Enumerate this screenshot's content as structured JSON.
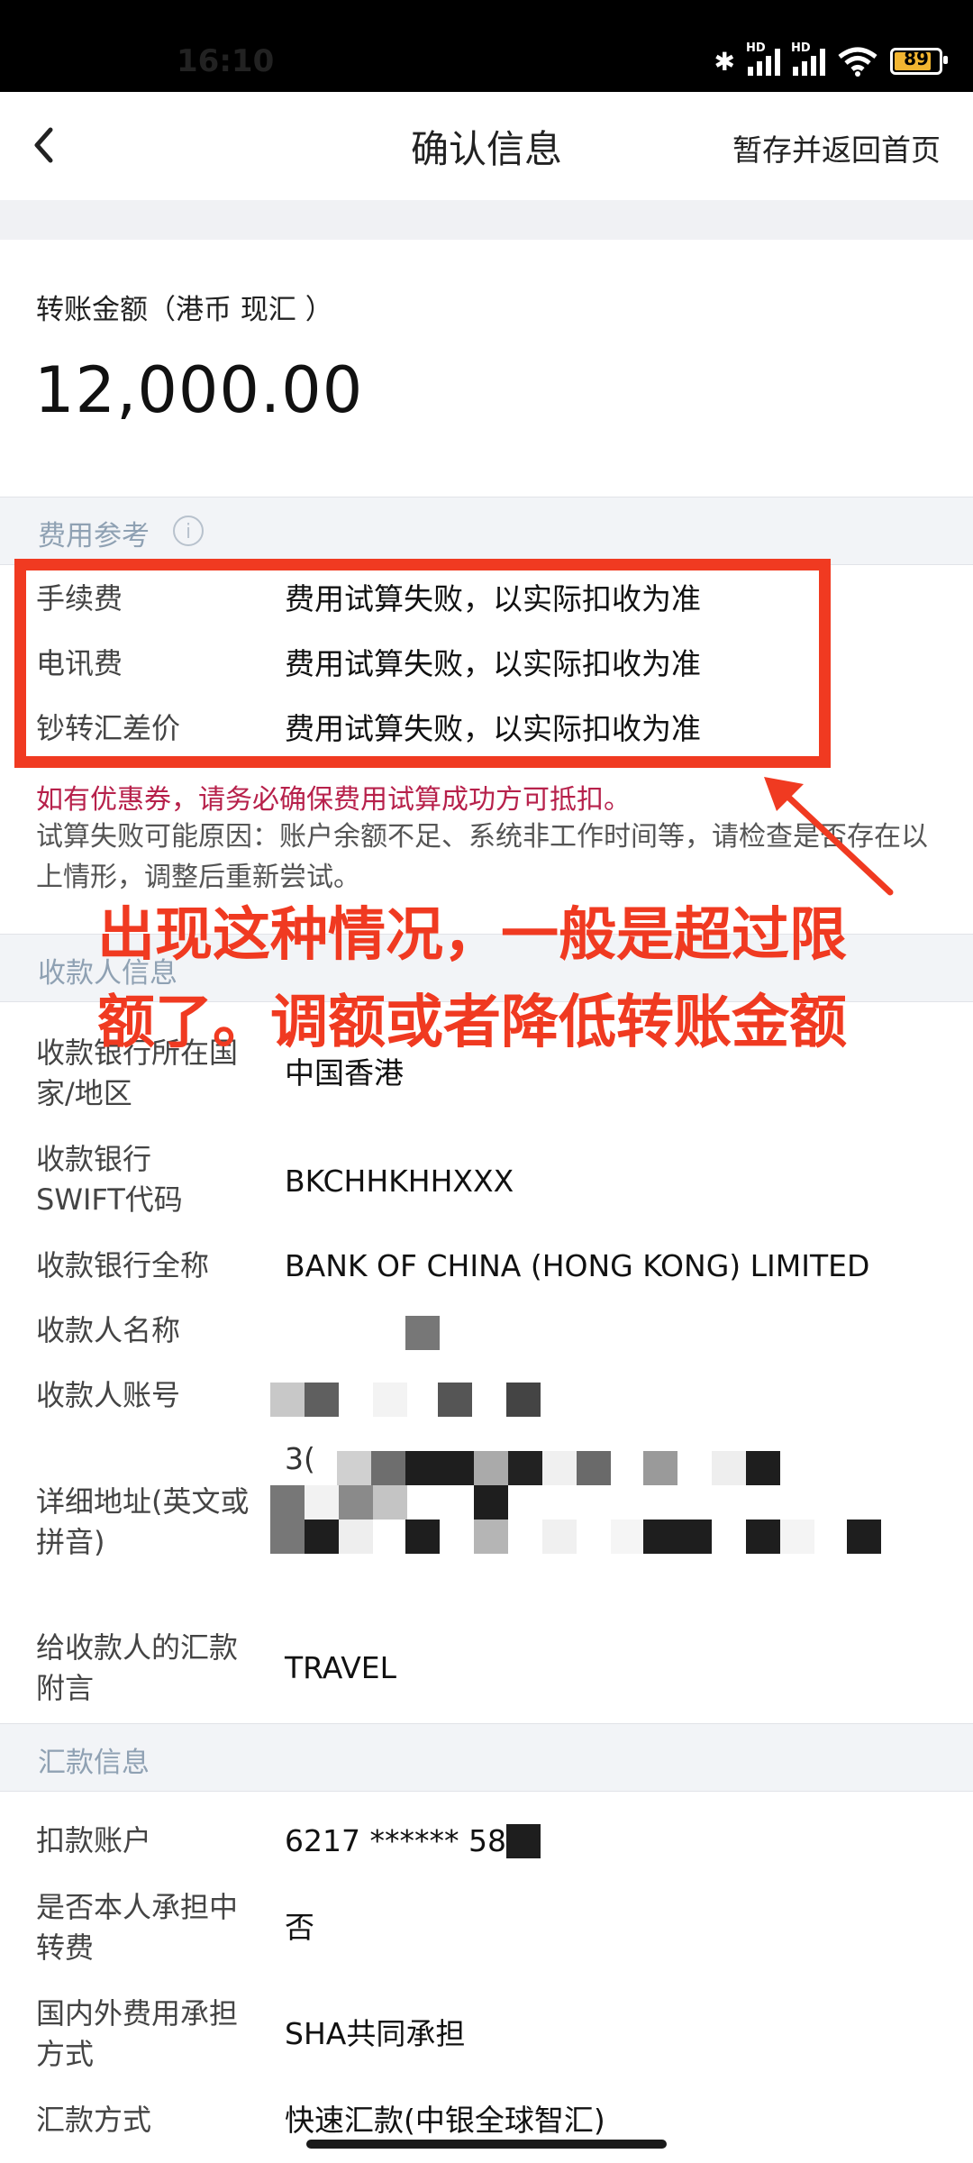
{
  "status_bar": {
    "time": "16:10",
    "battery": "89",
    "signal_badge": "HD",
    "icons": [
      "bluetooth-icon",
      "signal-hd-icon",
      "signal-hd-icon",
      "wifi-icon",
      "battery-icon"
    ]
  },
  "nav": {
    "title": "确认信息",
    "save_label": "暂存并返回首页",
    "back_icon": "chevron-left-icon"
  },
  "amount": {
    "label": "转账金额（港币 现汇 ）",
    "value": "12,000.00"
  },
  "fees": {
    "section_title": "费用参考",
    "items": [
      {
        "label": "手续费",
        "value": "费用试算失败，以实际扣收为准"
      },
      {
        "label": "电讯费",
        "value": "费用试算失败，以实际扣收为准"
      },
      {
        "label": "钞转汇差价",
        "value": "费用试算失败，以实际扣收为准"
      }
    ],
    "coupon_note": "如有优惠券，请务必确保费用试算成功方可抵扣。",
    "failure_reason": "试算失败可能原因：账户余额不足、系统非工作时间等，请检查是否存在以上情形，调整后重新尝试。"
  },
  "annotation": {
    "text": "出现这种情况，一般是超过限额了。调额或者降低转账金额",
    "color": "#f03a21"
  },
  "payee": {
    "section_title": "收款人信息",
    "bank_region_label": "收款银行所在国家/地区",
    "bank_region_value": "中国香港",
    "swift_label": "收款银行SWIFT代码",
    "swift_value": "BKCHHKHHXXX",
    "bank_name_label": "收款银行全称",
    "bank_name_value": "BANK OF CHINA (HONG KONG) LIMITED",
    "payee_name_label": "收款人名称",
    "account_label": "收款人账号",
    "address_label": "详细地址(英文或拼音)",
    "address_prefix": "3(",
    "remark_label": "给收款人的汇款附言",
    "remark_value": "TRAVEL"
  },
  "remit": {
    "section_title": "汇款信息",
    "debit_label": "扣款账户",
    "debit_value": "6217 ****** 58",
    "bear_fee_label": "是否本人承担中转费",
    "bear_fee_value": "否",
    "fee_mode_label": "国内外费用承担方式",
    "fee_mode_value": "SHA共同承担",
    "method_label": "汇款方式",
    "method_value": "快速汇款(中银全球智汇)"
  },
  "colors": {
    "highlight_red": "#f03a21",
    "coupon_red": "#b7214b",
    "section_bg": "#f2f4f7",
    "section_text": "#8fa1b3"
  }
}
